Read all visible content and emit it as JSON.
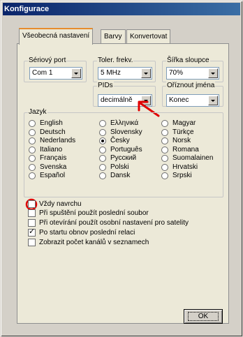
{
  "window": {
    "title": "Konfigurace"
  },
  "tabs": [
    {
      "label": "Všeobecná nastavení",
      "active": true
    },
    {
      "label": "Barvy",
      "active": false
    },
    {
      "label": "Konvertovat",
      "active": false
    }
  ],
  "serial_port": {
    "label": "Sériový port",
    "value": "Com 1"
  },
  "tolerance": {
    "label": "Toler. frekv.",
    "value": "5 MHz"
  },
  "column_width": {
    "label": "Šířka sloupce",
    "value": "70%"
  },
  "pids": {
    "label": "PIDs",
    "value": "decimálně"
  },
  "trim_names": {
    "label": "Oříznout jména",
    "value": "Konec"
  },
  "language": {
    "label": "Jazyk",
    "options": [
      {
        "label": "English",
        "selected": false
      },
      {
        "label": "Ελληνικά",
        "selected": false
      },
      {
        "label": "Magyar",
        "selected": false
      },
      {
        "label": "Deutsch",
        "selected": false
      },
      {
        "label": "Slovensky",
        "selected": false
      },
      {
        "label": "Türkçe",
        "selected": false
      },
      {
        "label": "Nederlands",
        "selected": false
      },
      {
        "label": "Česky",
        "selected": true
      },
      {
        "label": "Norsk",
        "selected": false
      },
      {
        "label": "Italiano",
        "selected": false
      },
      {
        "label": "Português",
        "selected": false
      },
      {
        "label": "Romana",
        "selected": false
      },
      {
        "label": "Français",
        "selected": false
      },
      {
        "label": "Русский",
        "selected": false
      },
      {
        "label": "Suomalainen",
        "selected": false
      },
      {
        "label": "Svenska",
        "selected": false
      },
      {
        "label": "Polski",
        "selected": false
      },
      {
        "label": "Hrvatski",
        "selected": false
      },
      {
        "label": "Español",
        "selected": false
      },
      {
        "label": "Dansk",
        "selected": false
      },
      {
        "label": "Srpski",
        "selected": false
      }
    ]
  },
  "options": [
    {
      "label": "Vždy navrchu",
      "checked": false
    },
    {
      "label": "Při spuštění použít poslední soubor",
      "checked": false
    },
    {
      "label": "Při otevírání použít osobní nastavení pro satelity",
      "checked": false
    },
    {
      "label": "Po startu obnov poslední relaci",
      "checked": true
    },
    {
      "label": "Zobrazit počet kanálů v seznamech",
      "checked": false
    }
  ],
  "ok_button": {
    "label": "OK"
  },
  "colors": {
    "annotation": "#e00000",
    "title_bar": "#0a246a"
  }
}
